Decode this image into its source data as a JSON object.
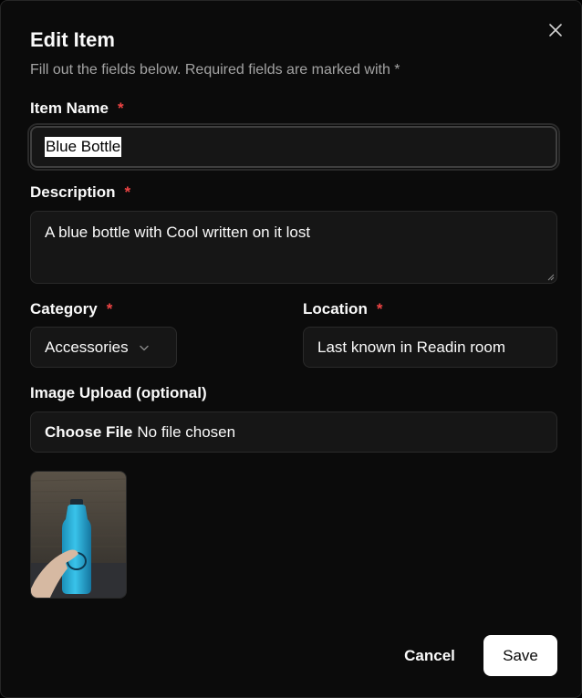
{
  "dialog": {
    "title": "Edit Item",
    "subtitle": "Fill out the fields below. Required fields are marked with *",
    "close_icon": "close-icon"
  },
  "form": {
    "name": {
      "label": "Item Name",
      "required_mark": "*",
      "value": "Blue Bottle"
    },
    "description": {
      "label": "Description",
      "required_mark": "*",
      "value": "A blue bottle with Cool written on it lost"
    },
    "category": {
      "label": "Category",
      "required_mark": "*",
      "selected": "Accessories",
      "icon": "chevron-down-icon"
    },
    "location": {
      "label": "Location",
      "required_mark": "*",
      "value": "Last known in Readin room"
    },
    "image_upload": {
      "label": "Image Upload (optional)",
      "button": "Choose File",
      "status": "No file chosen"
    }
  },
  "preview": {
    "subject": "blue-bottle-photo"
  },
  "actions": {
    "cancel": "Cancel",
    "save": "Save"
  },
  "colors": {
    "background": "#0b0b0b",
    "field": "#161616",
    "required": "#ef4444",
    "muted_text": "#a3a3a3",
    "primary_button": "#ffffff"
  }
}
